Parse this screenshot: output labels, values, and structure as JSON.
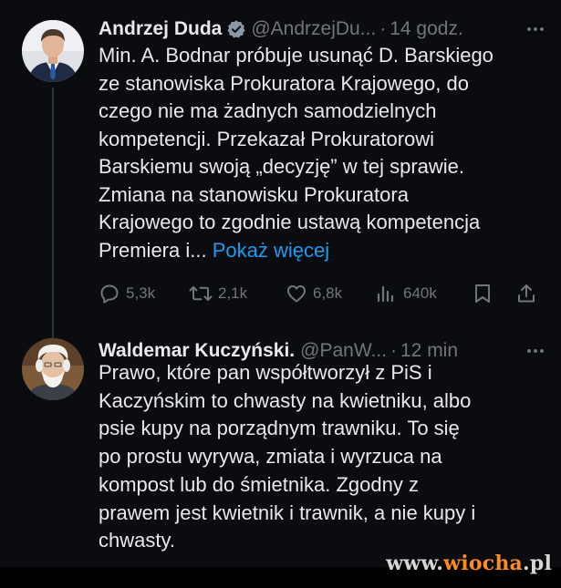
{
  "tweets": [
    {
      "author_name": "Andrzej Duda",
      "handle": "@AndrzejDu...",
      "separator": "·",
      "time": "14 godz.",
      "more": "···",
      "verified": true,
      "text_lines": [
        "Min. A. Bodnar próbuje usunąć D. Barskiego",
        "ze stanowiska Prokuratora Krajowego, do",
        "czego nie ma żadnych samodzielnych",
        "kompetencji. Przekazał Prokuratorowi",
        "Barskiemu swoją „decyzję” w tej sprawie.",
        "Zmiana na stanowisku Prokuratora",
        "Krajowego to zgodnie ustawą kompetencja"
      ],
      "last_line": "Premiera i...",
      "show_more": "Pokaż więcej",
      "actions": {
        "replies": "5,3k",
        "retweets": "2,1k",
        "likes": "6,8k",
        "views": "640k"
      }
    },
    {
      "author_name": "Waldemar Kuczyński.",
      "handle": "@PanW...",
      "separator": "·",
      "time": "12 min",
      "more": "···",
      "text_lines": [
        "Prawo, które pan współtworzył z PiS i",
        "Kaczyńskim to chwasty na kwietniku, albo",
        "psie kupy na porządnym trawniku. To się",
        "po prostu wyrywa, zmiata i wyrzuca na",
        "kompost lub do śmietnika. Zgodny z",
        "prawem jest kwietnik i trawnik, a nie kupy i",
        "chwasty."
      ]
    }
  ],
  "icons": {
    "reply": "reply-icon",
    "retweet": "retweet-icon",
    "like": "heart-icon",
    "views": "views-icon",
    "bookmark": "bookmark-icon",
    "share": "share-icon",
    "verified": "verified-badge-icon"
  },
  "colors": {
    "background": "#0a0c0f",
    "text": "#e7e9ea",
    "muted": "#71767b",
    "link": "#1d9bf0"
  },
  "watermark": {
    "prefix": "www.",
    "brand": "wiocha",
    "dot": ".",
    "suffix": "pl"
  }
}
